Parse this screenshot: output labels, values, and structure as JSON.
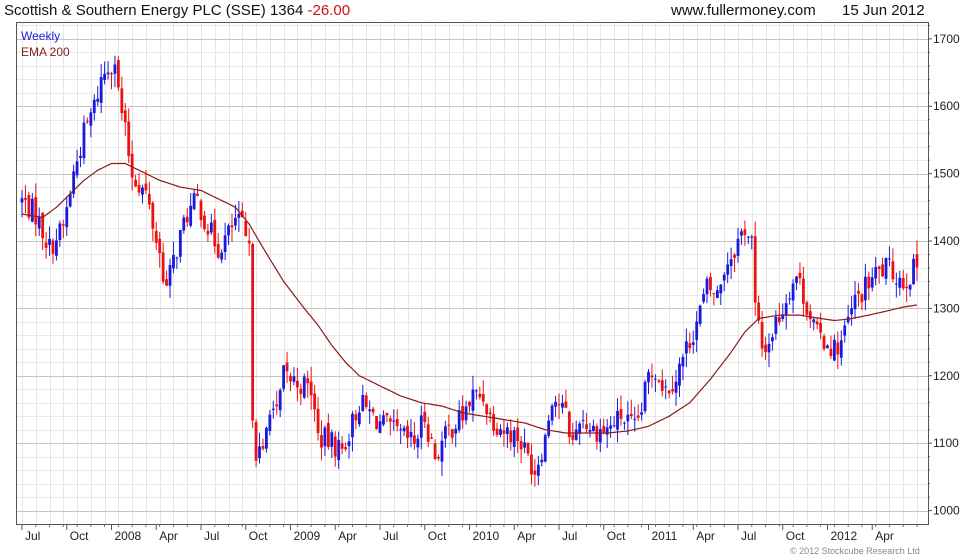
{
  "header": {
    "title": "Scottish & Southern Energy PLC (SSE) 1364",
    "change": "-26.00",
    "site": "www.fullermoney.com",
    "date": "15 Jun 2012"
  },
  "footer": {
    "copyright": "© 2012 Stockcube Research Ltd"
  },
  "colors": {
    "up": "#1a1adf",
    "down": "#ee1111",
    "ema": "#8b1a1a",
    "grid": "#d4d4d4",
    "frame": "#555555"
  },
  "chart_data": {
    "type": "candlestick",
    "interval": "Weekly",
    "ylim": [
      980,
      1725
    ],
    "yticks": [
      1000,
      1100,
      1200,
      1300,
      1400,
      1500,
      1600,
      1700
    ],
    "grid": true,
    "legend": {
      "placement": "top-left",
      "entries": [
        "Weekly",
        "EMA 200"
      ]
    },
    "x_tick_labels": [
      "Jul",
      "Oct",
      "2008",
      "Apr",
      "Jul",
      "Oct",
      "2009",
      "Apr",
      "Jul",
      "Oct",
      "2010",
      "Apr",
      "Jul",
      "Oct",
      "2011",
      "Apr",
      "Jul",
      "Oct",
      "2012",
      "Apr"
    ],
    "x_tick_weeks": [
      0,
      13,
      26,
      39,
      52,
      65,
      78,
      91,
      104,
      117,
      130,
      143,
      156,
      169,
      182,
      195,
      208,
      221,
      234,
      247
    ],
    "price_keypoints": [
      [
        0,
        1460
      ],
      [
        4,
        1440
      ],
      [
        8,
        1390
      ],
      [
        12,
        1420
      ],
      [
        15,
        1500
      ],
      [
        18,
        1560
      ],
      [
        21,
        1600
      ],
      [
        23,
        1640
      ],
      [
        25,
        1660
      ],
      [
        27,
        1670
      ],
      [
        28,
        1620
      ],
      [
        30,
        1560
      ],
      [
        32,
        1500
      ],
      [
        36,
        1470
      ],
      [
        40,
        1380
      ],
      [
        42,
        1330
      ],
      [
        45,
        1390
      ],
      [
        48,
        1440
      ],
      [
        51,
        1460
      ],
      [
        54,
        1420
      ],
      [
        57,
        1390
      ],
      [
        60,
        1410
      ],
      [
        62,
        1430
      ],
      [
        64,
        1420
      ],
      [
        66,
        1380
      ],
      [
        67,
        1150
      ],
      [
        68,
        1090
      ],
      [
        70,
        1080
      ],
      [
        72,
        1160
      ],
      [
        74,
        1140
      ],
      [
        76,
        1200
      ],
      [
        80,
        1190
      ],
      [
        84,
        1180
      ],
      [
        86,
        1110
      ],
      [
        90,
        1100
      ],
      [
        93,
        1090
      ],
      [
        96,
        1130
      ],
      [
        98,
        1160
      ],
      [
        102,
        1140
      ],
      [
        104,
        1130
      ],
      [
        107,
        1120
      ],
      [
        110,
        1110
      ],
      [
        114,
        1100
      ],
      [
        117,
        1140
      ],
      [
        120,
        1080
      ],
      [
        124,
        1120
      ],
      [
        128,
        1140
      ],
      [
        131,
        1170
      ],
      [
        134,
        1170
      ],
      [
        136,
        1140
      ],
      [
        140,
        1120
      ],
      [
        144,
        1110
      ],
      [
        147,
        1080
      ],
      [
        149,
        1060
      ],
      [
        152,
        1110
      ],
      [
        154,
        1170
      ],
      [
        156,
        1160
      ],
      [
        158,
        1140
      ],
      [
        160,
        1100
      ],
      [
        162,
        1140
      ],
      [
        166,
        1120
      ],
      [
        170,
        1120
      ],
      [
        174,
        1140
      ],
      [
        178,
        1120
      ],
      [
        180,
        1150
      ],
      [
        182,
        1200
      ],
      [
        184,
        1210
      ],
      [
        187,
        1180
      ],
      [
        190,
        1200
      ],
      [
        193,
        1240
      ],
      [
        196,
        1280
      ],
      [
        199,
        1330
      ],
      [
        202,
        1320
      ],
      [
        204,
        1360
      ],
      [
        207,
        1390
      ],
      [
        210,
        1420
      ],
      [
        212,
        1400
      ],
      [
        213,
        1300
      ],
      [
        215,
        1240
      ],
      [
        217,
        1250
      ],
      [
        219,
        1280
      ],
      [
        221,
        1300
      ],
      [
        223,
        1330
      ],
      [
        225,
        1350
      ],
      [
        227,
        1320
      ],
      [
        229,
        1290
      ],
      [
        231,
        1260
      ],
      [
        234,
        1250
      ],
      [
        236,
        1240
      ],
      [
        238,
        1250
      ],
      [
        240,
        1280
      ],
      [
        242,
        1310
      ],
      [
        245,
        1330
      ],
      [
        248,
        1350
      ],
      [
        251,
        1360
      ],
      [
        254,
        1350
      ],
      [
        256,
        1340
      ],
      [
        258,
        1350
      ],
      [
        260,
        1364
      ]
    ],
    "ema_keypoints": [
      [
        0,
        1440
      ],
      [
        6,
        1435
      ],
      [
        10,
        1450
      ],
      [
        14,
        1470
      ],
      [
        18,
        1490
      ],
      [
        22,
        1505
      ],
      [
        26,
        1515
      ],
      [
        30,
        1515
      ],
      [
        34,
        1505
      ],
      [
        40,
        1490
      ],
      [
        46,
        1480
      ],
      [
        52,
        1475
      ],
      [
        58,
        1460
      ],
      [
        62,
        1450
      ],
      [
        66,
        1425
      ],
      [
        70,
        1390
      ],
      [
        76,
        1340
      ],
      [
        82,
        1300
      ],
      [
        86,
        1275
      ],
      [
        90,
        1245
      ],
      [
        94,
        1220
      ],
      [
        98,
        1200
      ],
      [
        104,
        1185
      ],
      [
        110,
        1170
      ],
      [
        116,
        1160
      ],
      [
        122,
        1155
      ],
      [
        128,
        1145
      ],
      [
        134,
        1140
      ],
      [
        140,
        1135
      ],
      [
        146,
        1130
      ],
      [
        152,
        1120
      ],
      [
        158,
        1115
      ],
      [
        164,
        1115
      ],
      [
        170,
        1115
      ],
      [
        176,
        1118
      ],
      [
        182,
        1125
      ],
      [
        188,
        1140
      ],
      [
        194,
        1160
      ],
      [
        200,
        1195
      ],
      [
        206,
        1235
      ],
      [
        210,
        1265
      ],
      [
        214,
        1285
      ],
      [
        220,
        1290
      ],
      [
        226,
        1290
      ],
      [
        232,
        1285
      ],
      [
        236,
        1282
      ],
      [
        240,
        1284
      ],
      [
        246,
        1290
      ],
      [
        252,
        1297
      ],
      [
        256,
        1302
      ],
      [
        260,
        1305
      ]
    ]
  }
}
